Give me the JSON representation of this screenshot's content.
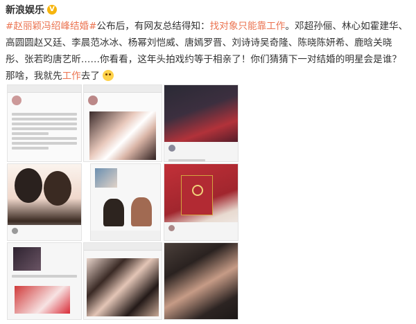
{
  "post": {
    "author": "新浪娱乐",
    "verified_badge": "V",
    "hashtag": "#赵丽颖冯绍峰结婚#",
    "text_1": "公布后，有网友总结得知：",
    "link_1": "找对象只能靠工作",
    "text_2": "。邓超孙俪、林心如霍建华、高圆圆赵又廷、李晨范冰冰、杨幂刘恺威、唐嫣罗晋、刘诗诗吴奇隆、陈晓陈妍希、鹿晗关晓彤、张若昀唐艺昕……你看看，这年头拍戏约等于相亲了！你们猜猜下一对结婚的明星会是谁？那啥，我就先",
    "link_2": "工作",
    "text_3": "去了",
    "emoji": "smile-emoji"
  },
  "images": [
    {
      "name": "screenshot-weibo-1",
      "caption": "微博截图"
    },
    {
      "name": "screenshot-weibo-2",
      "caption": "微博截图"
    },
    {
      "name": "photo-couple-1",
      "caption": "合照"
    },
    {
      "name": "photo-couple-2",
      "caption": "合照"
    },
    {
      "name": "photo-couple-3",
      "caption": "合照"
    },
    {
      "name": "photo-marriage-certificate",
      "caption": "结婚证"
    },
    {
      "name": "screenshot-weibo-3",
      "caption": "微博截图"
    },
    {
      "name": "photo-couple-4",
      "caption": "合照"
    },
    {
      "name": "photo-couple-5",
      "caption": "合照"
    }
  ]
}
